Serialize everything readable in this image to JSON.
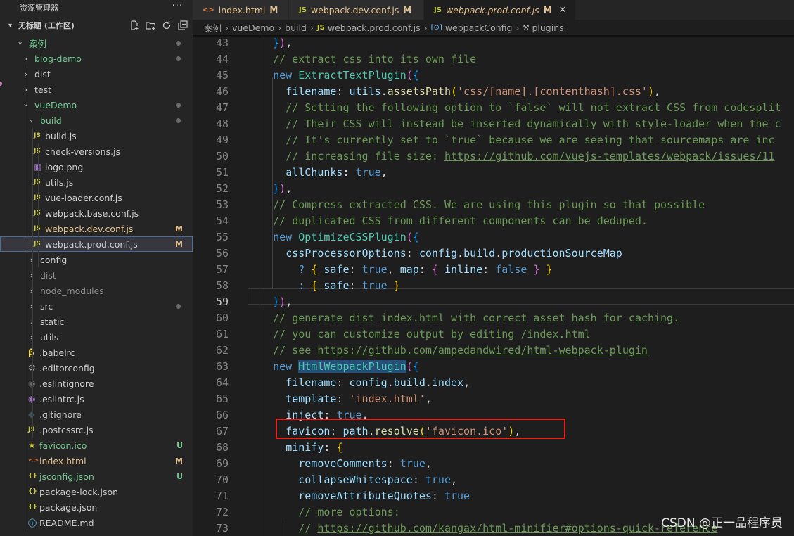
{
  "sidebar": {
    "title": "资源管理器",
    "more": "···",
    "workspace": "无标题 (工作区)",
    "actions": [
      "new-file",
      "new-folder",
      "refresh",
      "collapse-all"
    ],
    "items": [
      {
        "label": "案例",
        "depth": 0,
        "kind": "folder-open",
        "dot": true,
        "color": "#73c991"
      },
      {
        "label": "blog-demo",
        "depth": 1,
        "kind": "folder",
        "dot": true,
        "color": "#73c991"
      },
      {
        "label": "dist",
        "depth": 1,
        "kind": "folder"
      },
      {
        "label": "test",
        "depth": 1,
        "kind": "folder"
      },
      {
        "label": "vueDemo",
        "depth": 1,
        "kind": "folder-open",
        "dot": true,
        "color": "#73c991"
      },
      {
        "label": "build",
        "depth": 2,
        "kind": "folder-open",
        "dot": true,
        "color": "#73c991"
      },
      {
        "label": "build.js",
        "depth": 3,
        "kind": "js"
      },
      {
        "label": "check-versions.js",
        "depth": 3,
        "kind": "js"
      },
      {
        "label": "logo.png",
        "depth": 3,
        "kind": "image"
      },
      {
        "label": "utils.js",
        "depth": 3,
        "kind": "js"
      },
      {
        "label": "vue-loader.conf.js",
        "depth": 3,
        "kind": "js"
      },
      {
        "label": "webpack.base.conf.js",
        "depth": 3,
        "kind": "js"
      },
      {
        "label": "webpack.dev.conf.js",
        "depth": 3,
        "kind": "js",
        "badge": "M",
        "color": "#e2c08d"
      },
      {
        "label": "webpack.prod.conf.js",
        "depth": 3,
        "kind": "js",
        "badge": "M",
        "selected": true
      },
      {
        "label": "config",
        "depth": 2,
        "kind": "folder"
      },
      {
        "label": "dist",
        "depth": 2,
        "kind": "folder",
        "dim": true
      },
      {
        "label": "node_modules",
        "depth": 2,
        "kind": "folder",
        "dim": true
      },
      {
        "label": "src",
        "depth": 2,
        "kind": "folder",
        "dot": true
      },
      {
        "label": "static",
        "depth": 2,
        "kind": "folder"
      },
      {
        "label": "utils",
        "depth": 2,
        "kind": "folder"
      },
      {
        "label": ".babelrc",
        "depth": 2,
        "kind": "babel"
      },
      {
        "label": ".editorconfig",
        "depth": 2,
        "kind": "gear"
      },
      {
        "label": ".eslintignore",
        "depth": 2,
        "kind": "eslint-ignore"
      },
      {
        "label": ".eslintrc.js",
        "depth": 2,
        "kind": "eslint"
      },
      {
        "label": ".gitignore",
        "depth": 2,
        "kind": "git"
      },
      {
        "label": ".postcssrc.js",
        "depth": 2,
        "kind": "js"
      },
      {
        "label": "favicon.ico",
        "depth": 2,
        "kind": "star",
        "badge": "U",
        "color": "#73c991"
      },
      {
        "label": "index.html",
        "depth": 2,
        "kind": "html",
        "badge": "M",
        "color": "#e2c08d"
      },
      {
        "label": "jsconfig.json",
        "depth": 2,
        "kind": "json",
        "badge": "U",
        "color": "#73c991"
      },
      {
        "label": "package-lock.json",
        "depth": 2,
        "kind": "json"
      },
      {
        "label": "package.json",
        "depth": 2,
        "kind": "json"
      },
      {
        "label": "README.md",
        "depth": 2,
        "kind": "info"
      }
    ]
  },
  "tabs": [
    {
      "label": "index.html",
      "mark": "M",
      "icon": "<>",
      "active": false
    },
    {
      "label": "webpack.dev.conf.js",
      "mark": "M",
      "icon": "JS",
      "active": false
    },
    {
      "label": "webpack.prod.conf.js",
      "mark": "M",
      "icon": "JS",
      "active": true,
      "close": "✕"
    }
  ],
  "breadcrumb": [
    "案例",
    "vueDemo",
    "build",
    "webpack.prod.conf.js",
    "webpackConfig",
    "plugins"
  ],
  "editor": {
    "first_line": 43,
    "current_line": 59,
    "lines": [
      [
        [
          "    ",
          ""
        ],
        [
          "}",
          "b3"
        ],
        [
          ")",
          "b2"
        ],
        [
          ",",
          ""
        ]
      ],
      [
        [
          "    ",
          ""
        ],
        [
          "// extract css into its own file",
          "c"
        ]
      ],
      [
        [
          "    ",
          ""
        ],
        [
          "new",
          "k"
        ],
        [
          " ",
          ""
        ],
        [
          "ExtractTextPlugin",
          "cls"
        ],
        [
          "(",
          "b2"
        ],
        [
          "{",
          "b3"
        ]
      ],
      [
        [
          "      ",
          ""
        ],
        [
          "filename",
          "p"
        ],
        [
          ": ",
          ""
        ],
        [
          "utils",
          "p"
        ],
        [
          ".",
          ""
        ],
        [
          "assetsPath",
          "fn"
        ],
        [
          "(",
          "b1"
        ],
        [
          "'css/[name].[contenthash].css'",
          "s"
        ],
        [
          ")",
          "b1"
        ],
        [
          ",",
          ""
        ]
      ],
      [
        [
          "      ",
          ""
        ],
        [
          "// Setting the following option to `false` will not extract CSS from codesplit",
          "c"
        ]
      ],
      [
        [
          "      ",
          ""
        ],
        [
          "// Their CSS will instead be inserted dynamically with style-loader when the c",
          "c"
        ]
      ],
      [
        [
          "      ",
          ""
        ],
        [
          "// It's currently set to `true` because we are seeing that sourcemaps are inc",
          "c"
        ]
      ],
      [
        [
          "      ",
          ""
        ],
        [
          "// increasing file size: ",
          "c"
        ],
        [
          "https://github.com/vuejs-templates/webpack/issues/11",
          "c u"
        ]
      ],
      [
        [
          "      ",
          ""
        ],
        [
          "allChunks",
          "p"
        ],
        [
          ": ",
          ""
        ],
        [
          "true",
          "k"
        ],
        [
          ",",
          ""
        ]
      ],
      [
        [
          "    ",
          ""
        ],
        [
          "}",
          "b3"
        ],
        [
          ")",
          "b2"
        ],
        [
          ",",
          ""
        ]
      ],
      [
        [
          "    ",
          ""
        ],
        [
          "// Compress extracted CSS. We are using this plugin so that possible",
          "c"
        ]
      ],
      [
        [
          "    ",
          ""
        ],
        [
          "// duplicated CSS from different components can be deduped.",
          "c"
        ]
      ],
      [
        [
          "    ",
          ""
        ],
        [
          "new",
          "k"
        ],
        [
          " ",
          ""
        ],
        [
          "OptimizeCSSPlugin",
          "cls"
        ],
        [
          "(",
          "b2"
        ],
        [
          "{",
          "b3"
        ]
      ],
      [
        [
          "      ",
          ""
        ],
        [
          "cssProcessorOptions",
          "p"
        ],
        [
          ": ",
          ""
        ],
        [
          "config",
          "p"
        ],
        [
          ".",
          ""
        ],
        [
          "build",
          "p"
        ],
        [
          ".",
          ""
        ],
        [
          "productionSourceMap",
          "p"
        ]
      ],
      [
        [
          "        ",
          ""
        ],
        [
          "? ",
          "k"
        ],
        [
          "{",
          "b1"
        ],
        [
          " ",
          ""
        ],
        [
          "safe",
          "p"
        ],
        [
          ": ",
          ""
        ],
        [
          "true",
          "k"
        ],
        [
          ", ",
          ""
        ],
        [
          "map",
          "p"
        ],
        [
          ": ",
          ""
        ],
        [
          "{",
          "b2"
        ],
        [
          " ",
          ""
        ],
        [
          "inline",
          "p"
        ],
        [
          ": ",
          ""
        ],
        [
          "false",
          "k"
        ],
        [
          " ",
          ""
        ],
        [
          "}",
          "b2"
        ],
        [
          " ",
          ""
        ],
        [
          "}",
          "b1"
        ]
      ],
      [
        [
          "        ",
          ""
        ],
        [
          ": ",
          "k"
        ],
        [
          "{",
          "b1"
        ],
        [
          " ",
          ""
        ],
        [
          "safe",
          "p"
        ],
        [
          ": ",
          ""
        ],
        [
          "true",
          "k"
        ],
        [
          " ",
          ""
        ],
        [
          "}",
          "b1"
        ]
      ],
      [
        [
          "    ",
          ""
        ],
        [
          "}",
          "b3"
        ],
        [
          ")",
          "b2"
        ],
        [
          ",",
          ""
        ]
      ],
      [
        [
          "    ",
          ""
        ],
        [
          "// generate dist index.html with correct asset hash for caching.",
          "c"
        ]
      ],
      [
        [
          "    ",
          ""
        ],
        [
          "// you can customize output by editing /index.html",
          "c"
        ]
      ],
      [
        [
          "    ",
          ""
        ],
        [
          "// see ",
          "c"
        ],
        [
          "https://github.com/ampedandwired/html-webpack-plugin",
          "c u"
        ]
      ],
      [
        [
          "    ",
          ""
        ],
        [
          "new",
          "k"
        ],
        [
          " ",
          ""
        ],
        [
          "HtmlWebpackPlugin",
          "cls hl"
        ],
        [
          "(",
          "b2"
        ],
        [
          "{",
          "b3"
        ]
      ],
      [
        [
          "      ",
          ""
        ],
        [
          "filename",
          "p"
        ],
        [
          ": ",
          ""
        ],
        [
          "config",
          "p"
        ],
        [
          ".",
          ""
        ],
        [
          "build",
          "p"
        ],
        [
          ".",
          ""
        ],
        [
          "index",
          "p"
        ],
        [
          ",",
          ""
        ]
      ],
      [
        [
          "      ",
          ""
        ],
        [
          "template",
          "p"
        ],
        [
          ": ",
          ""
        ],
        [
          "'index.html'",
          "s"
        ],
        [
          ",",
          ""
        ]
      ],
      [
        [
          "      ",
          ""
        ],
        [
          "inject",
          "p"
        ],
        [
          ": ",
          ""
        ],
        [
          "true",
          "k"
        ],
        [
          ",",
          ""
        ]
      ],
      [
        [
          "      ",
          ""
        ],
        [
          "favicon",
          "p"
        ],
        [
          ": ",
          ""
        ],
        [
          "path",
          "p"
        ],
        [
          ".",
          ""
        ],
        [
          "resolve",
          "fn"
        ],
        [
          "(",
          "b1"
        ],
        [
          "'favicon.ico'",
          "s"
        ],
        [
          ")",
          "b1"
        ],
        [
          ",",
          ""
        ]
      ],
      [
        [
          "      ",
          ""
        ],
        [
          "minify",
          "p"
        ],
        [
          ": ",
          ""
        ],
        [
          "{",
          "b1"
        ]
      ],
      [
        [
          "        ",
          ""
        ],
        [
          "removeComments",
          "p"
        ],
        [
          ": ",
          ""
        ],
        [
          "true",
          "k"
        ],
        [
          ",",
          ""
        ]
      ],
      [
        [
          "        ",
          ""
        ],
        [
          "collapseWhitespace",
          "p"
        ],
        [
          ": ",
          ""
        ],
        [
          "true",
          "k"
        ],
        [
          ",",
          ""
        ]
      ],
      [
        [
          "        ",
          ""
        ],
        [
          "removeAttributeQuotes",
          "p"
        ],
        [
          ": ",
          ""
        ],
        [
          "true",
          "k"
        ]
      ],
      [
        [
          "        ",
          ""
        ],
        [
          "// more options:",
          "c"
        ]
      ],
      [
        [
          "        ",
          ""
        ],
        [
          "// ",
          "c"
        ],
        [
          "https://github.com/kangax/html-minifier#options-quick-reference",
          "c u"
        ]
      ]
    ]
  },
  "watermark": "CSDN @正一品程序员",
  "colors": {
    "sidebar_bg": "#252526",
    "editor_bg": "#1e1e1e",
    "modified": "#e2c08d",
    "untracked": "#73c991",
    "highlight_box": "#e5221b"
  }
}
